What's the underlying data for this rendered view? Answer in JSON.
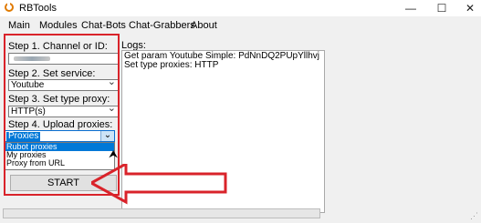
{
  "window": {
    "title": "RBTools",
    "minimize_glyph": "—",
    "maximize_glyph": "☐",
    "close_glyph": "✕"
  },
  "menu": [
    "Main",
    "Modules",
    "Chat-Bots",
    "Chat-Grabbers",
    "About"
  ],
  "steps": {
    "step1_label": "Step 1. Channel or ID:",
    "step2_label": "Step 2. Set service:",
    "step2_value": "Youtube",
    "step3_label": "Step 3. Set type proxy:",
    "step3_value": "HTTP(s)",
    "step4_label": "Step 4. Upload proxies:",
    "step4_value": "Proxies",
    "step4_options": [
      "Rubot proxies",
      "My proxies",
      "Proxy from URL"
    ],
    "step4_highlighted": "Rubot proxies"
  },
  "start_label": "START",
  "logs": {
    "label": "Logs:",
    "lines": [
      "Get param Youtube Simple: PdNnDQ2PUpYllhvj",
      "Set type proxies: HTTP"
    ]
  },
  "progress": {
    "fraction": 0
  },
  "colors": {
    "annotation": "#d9232a",
    "selection": "#0078d7"
  }
}
